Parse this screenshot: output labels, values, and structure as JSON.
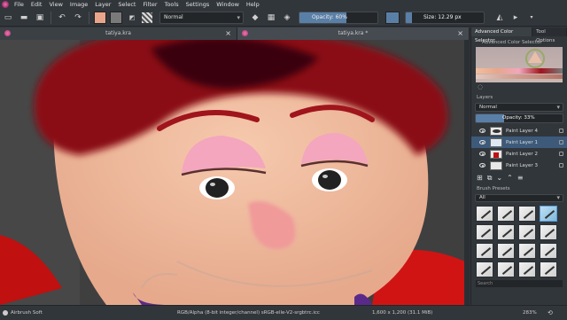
{
  "menu": {
    "items": [
      "File",
      "Edit",
      "View",
      "Image",
      "Layer",
      "Select",
      "Filter",
      "Tools",
      "Settings",
      "Window",
      "Help"
    ]
  },
  "toolbar": {
    "blend_mode": "Normal",
    "opacity_label": "Opacity: 60%",
    "opacity_value": 0.6,
    "size_label": "Size: 12.29 px",
    "fg_color": "#e9a58c",
    "bg_color": "#7a7a7a"
  },
  "documents": {
    "tabs": [
      {
        "title": "tatiya.kra"
      },
      {
        "title": "tatiya.kra *"
      }
    ]
  },
  "right_panel": {
    "tabs": [
      "Advanced Color Selector",
      "Tool Options"
    ],
    "acs_title": "Advanced Color Selector",
    "layers_title": "Layers",
    "layer_mode": "Normal",
    "layer_opacity": "Opacity:  33%",
    "layers": [
      {
        "name": "Paint Layer 4",
        "selected": false
      },
      {
        "name": "Paint Layer 1",
        "selected": true
      },
      {
        "name": "Paint Layer 2",
        "selected": false
      },
      {
        "name": "Paint Layer 3",
        "selected": false
      }
    ],
    "presets_title": "Brush Presets",
    "presets_filter": "All",
    "search_placeholder": "Search"
  },
  "status": {
    "brush": "Airbrush Soft",
    "color_info": "RGB/Alpha (8-bit integer/channel)  sRGB-elle-V2-srgbtrc.icc",
    "dimensions": "1,600 x 1,200 (31.1 MiB)",
    "zoom": "283%"
  },
  "colors": {
    "accent": "#3d5a7a",
    "hair": "#a0141c",
    "skin": "#f2bfa0",
    "eyeshadow": "#f3a6bd"
  }
}
